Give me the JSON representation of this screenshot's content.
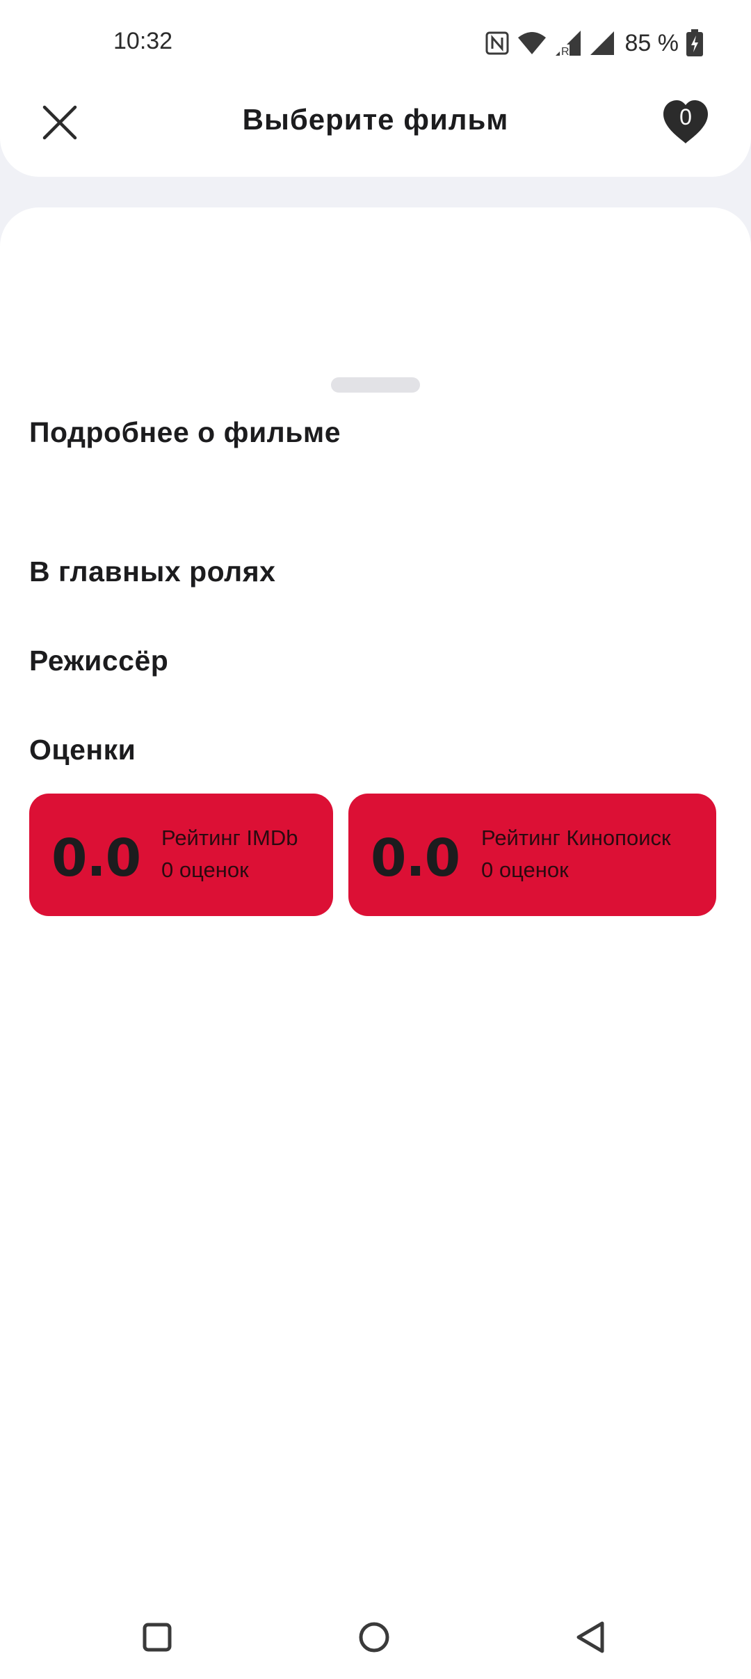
{
  "status_bar": {
    "time": "10:32",
    "battery": "85 %",
    "icons": [
      "nfc-icon",
      "wifi-icon",
      "signal-roaming-icon",
      "signal-icon",
      "battery-charging-icon"
    ]
  },
  "header": {
    "title": "Выберите фильм",
    "close_icon": "close-icon",
    "favorites_count": "0",
    "favorites_icon": "heart-icon"
  },
  "sheet": {
    "sections": {
      "about": "Подробнее о фильме",
      "cast": "В главных ролях",
      "director": "Режиссёр",
      "ratings": "Оценки"
    },
    "ratings": [
      {
        "score": "0.0",
        "label": "Рейтинг IMDb",
        "count": "0 оценок"
      },
      {
        "score": "0.0",
        "label": "Рейтинг Кинопоиск",
        "count": "0 оценок"
      }
    ]
  },
  "nav_bar": {
    "icons": [
      "recents-square-icon",
      "home-circle-icon",
      "back-triangle-icon"
    ]
  },
  "colors": {
    "accent": "#dc1035",
    "background": "#f0f1f6",
    "text": "#1c1c1e"
  }
}
